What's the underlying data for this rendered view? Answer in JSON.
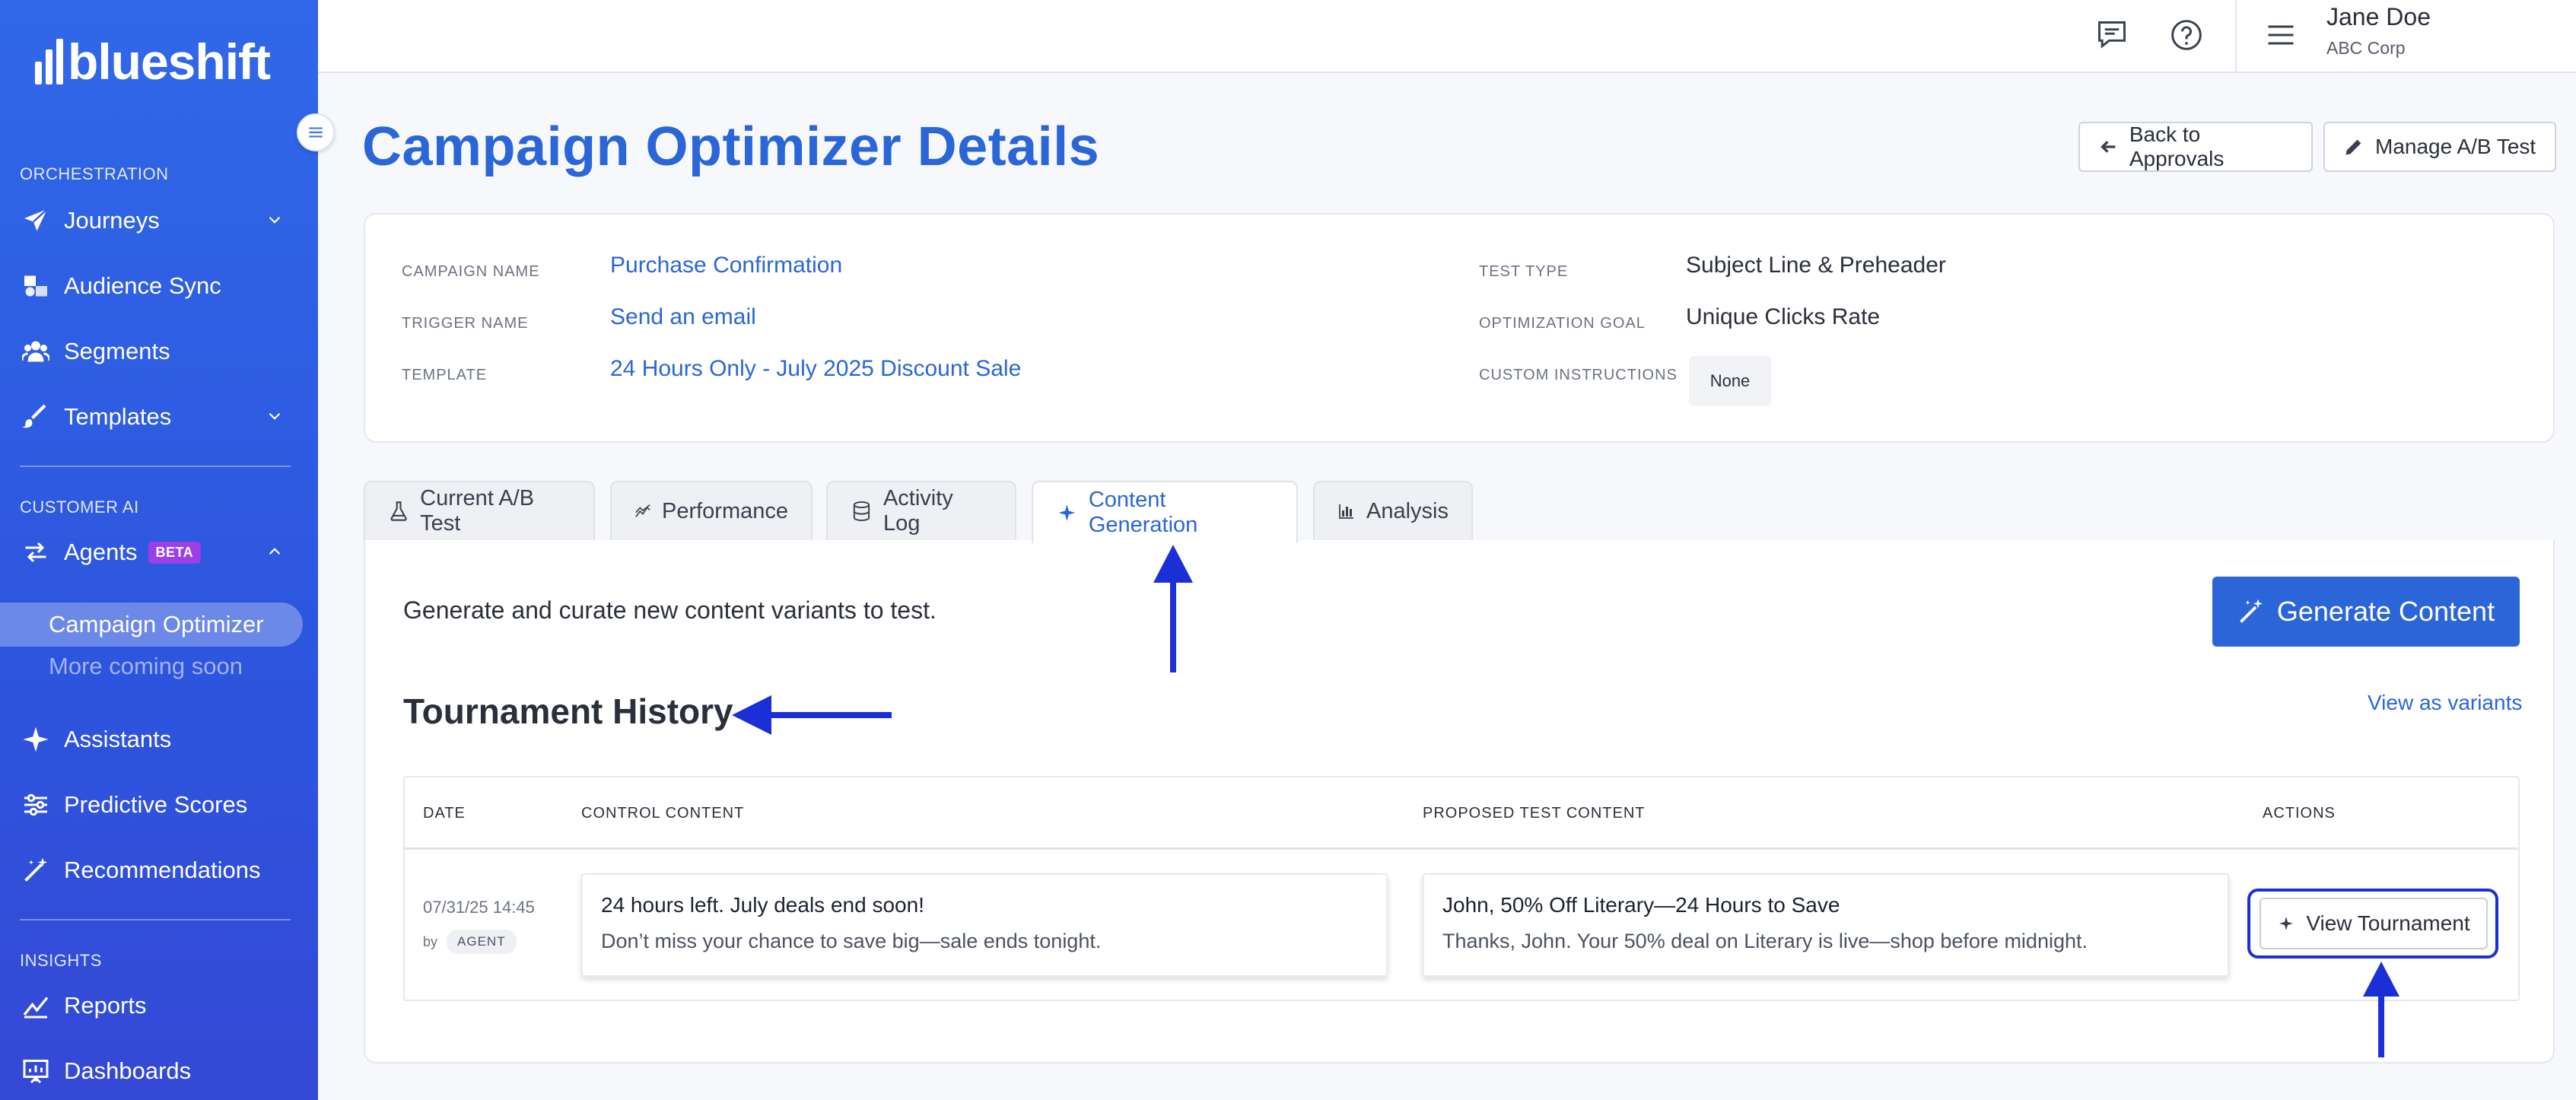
{
  "sidebar": {
    "logo": "blueshift",
    "sections": {
      "orchestration": "ORCHESTRATION",
      "customer_ai": "CUSTOMER AI",
      "insights": "INSIGHTS"
    },
    "items": {
      "journeys": "Journeys",
      "audience_sync": "Audience Sync",
      "segments": "Segments",
      "templates": "Templates",
      "agents": "Agents",
      "agents_badge": "BETA",
      "campaign_optimizer": "Campaign Optimizer",
      "more_coming": "More coming soon",
      "assistants": "Assistants",
      "predictive_scores": "Predictive Scores",
      "recommendations": "Recommendations",
      "reports": "Reports",
      "dashboards": "Dashboards"
    }
  },
  "topbar": {
    "user_name": "Jane Doe",
    "user_org": "ABC Corp"
  },
  "header": {
    "title": "Campaign Optimizer Details",
    "back_button": "Back to Approvals",
    "manage_button": "Manage A/B Test"
  },
  "details": {
    "campaign_name_label": "CAMPAIGN NAME",
    "campaign_name": "Purchase Confirmation",
    "trigger_name_label": "TRIGGER NAME",
    "trigger_name": "Send an email",
    "template_label": "TEMPLATE",
    "template": "24 Hours Only - July 2025 Discount Sale",
    "test_type_label": "TEST TYPE",
    "test_type": "Subject Line & Preheader",
    "goal_label": "OPTIMIZATION GOAL",
    "goal": "Unique Clicks Rate",
    "instructions_label": "CUSTOM INSTRUCTIONS",
    "instructions": "None"
  },
  "tabs": [
    {
      "label": "Current A/B Test"
    },
    {
      "label": "Performance"
    },
    {
      "label": "Activity Log"
    },
    {
      "label": "Content Generation"
    },
    {
      "label": "Analysis"
    }
  ],
  "content_generation": {
    "description": "Generate and curate new content variants to test.",
    "generate_button": "Generate Content",
    "section_title": "Tournament History",
    "view_as_variants": "View as variants",
    "columns": {
      "date": "DATE",
      "control": "CONTROL CONTENT",
      "proposed": "PROPOSED TEST CONTENT",
      "actions": "ACTIONS"
    },
    "rows": [
      {
        "date": "07/31/25 14:45",
        "by": "by",
        "author": "AGENT",
        "control_title": "24 hours left. July deals end soon!",
        "control_body": "Don’t miss your chance to save big—sale ends tonight.",
        "proposed_title": "John, 50% Off Literary—24 Hours to Save",
        "proposed_body": "Thanks, John. Your 50% deal on Literary is live—shop before midnight.",
        "action": "View Tournament"
      }
    ]
  },
  "colors": {
    "brand": "#2b66d8",
    "sidebar": "#2d55de",
    "annotation": "#1b2fd6",
    "beta_badge": "#9b3fe6"
  }
}
